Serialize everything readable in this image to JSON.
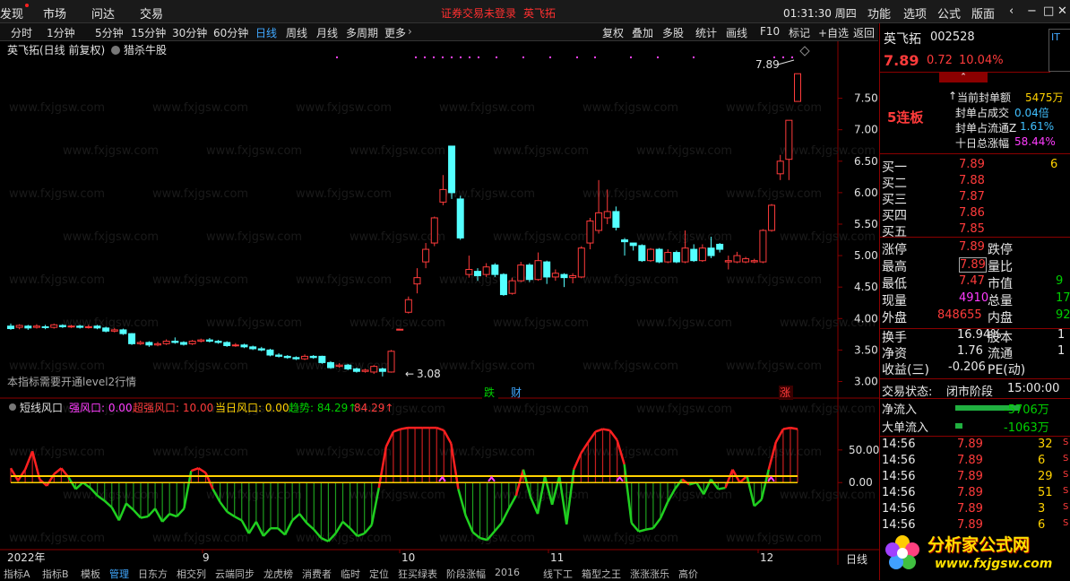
{
  "menubar": {
    "items": [
      "发现",
      "市场",
      "问达",
      "交易"
    ],
    "status_notice": "证券交易未登录",
    "stock_name_top": "英飞拓",
    "clock": "01:31:30 周四",
    "right_items": [
      "功能",
      "选项",
      "公式",
      "版面"
    ],
    "window_controls": [
      "‹",
      "−",
      "□",
      "✕"
    ]
  },
  "periodbar": {
    "periods": [
      "分时",
      "1分钟",
      "5分钟",
      "15分钟",
      "30分钟",
      "60分钟",
      "日线",
      "周线",
      "月线",
      "多周期",
      "更多"
    ],
    "active": "日线",
    "tools": [
      "复权",
      "叠加",
      "多股",
      "统计",
      "画线",
      "F10",
      "标记",
      "+自选",
      "返回"
    ]
  },
  "chart": {
    "title": "英飞拓(日线 前复权)",
    "indicator_name": "猎杀牛股",
    "high_label": "7.89",
    "low_label": "3.08",
    "level2_note": "本指标需要开通level2行情",
    "markers": {
      "die": "跌",
      "cai": "财",
      "zhang": "涨"
    },
    "y_labels": [
      "7.50",
      "7.00",
      "6.50",
      "6.00",
      "5.50",
      "5.00",
      "4.50",
      "4.00",
      "3.50",
      "3.00"
    ],
    "x_labels": [
      "2022年",
      "9",
      "10",
      "11",
      "12"
    ],
    "period_label": "日线",
    "sub_y_labels": [
      "50.00",
      "0.00"
    ],
    "sub_title": "短线风口",
    "sub_legend": [
      {
        "label": "强风口:",
        "value": "0.00",
        "color": "#ff3cff"
      },
      {
        "label": "超强风口:",
        "value": "10.00",
        "color": "#ff3b3b"
      },
      {
        "label": "当日风口:",
        "value": "0.00",
        "color": "#ffd200"
      },
      {
        "label": "趋势:",
        "value": "84.29↑",
        "color": "#00d000"
      },
      {
        "label": "",
        "value": "84.29↑",
        "color": "#ff3b3b"
      }
    ]
  },
  "chart_data": {
    "type": "candlestick",
    "y_range": [
      2.85,
      7.95
    ],
    "candles": [
      {
        "o": 3.88,
        "c": 3.84,
        "h": 3.92,
        "l": 3.82
      },
      {
        "o": 3.86,
        "c": 3.89,
        "h": 3.91,
        "l": 3.83
      },
      {
        "o": 3.88,
        "c": 3.85,
        "h": 3.9,
        "l": 3.82
      },
      {
        "o": 3.86,
        "c": 3.88,
        "h": 3.91,
        "l": 3.84
      },
      {
        "o": 3.87,
        "c": 3.86,
        "h": 3.9,
        "l": 3.83
      },
      {
        "o": 3.86,
        "c": 3.9,
        "h": 3.92,
        "l": 3.84
      },
      {
        "o": 3.89,
        "c": 3.87,
        "h": 3.91,
        "l": 3.85
      },
      {
        "o": 3.87,
        "c": 3.88,
        "h": 3.9,
        "l": 3.85
      },
      {
        "o": 3.88,
        "c": 3.86,
        "h": 3.9,
        "l": 3.84
      },
      {
        "o": 3.86,
        "c": 3.87,
        "h": 3.9,
        "l": 3.84
      },
      {
        "o": 3.88,
        "c": 3.85,
        "h": 3.9,
        "l": 3.83
      },
      {
        "o": 3.85,
        "c": 3.8,
        "h": 3.87,
        "l": 3.78
      },
      {
        "o": 3.8,
        "c": 3.82,
        "h": 3.85,
        "l": 3.78
      },
      {
        "o": 3.82,
        "c": 3.76,
        "h": 3.84,
        "l": 3.74
      },
      {
        "o": 3.76,
        "c": 3.6,
        "h": 3.77,
        "l": 3.58
      },
      {
        "o": 3.6,
        "c": 3.62,
        "h": 3.65,
        "l": 3.58
      },
      {
        "o": 3.62,
        "c": 3.58,
        "h": 3.64,
        "l": 3.55
      },
      {
        "o": 3.58,
        "c": 3.6,
        "h": 3.63,
        "l": 3.56
      },
      {
        "o": 3.6,
        "c": 3.64,
        "h": 3.67,
        "l": 3.58
      },
      {
        "o": 3.64,
        "c": 3.62,
        "h": 3.7,
        "l": 3.6
      },
      {
        "o": 3.62,
        "c": 3.59,
        "h": 3.64,
        "l": 3.57
      },
      {
        "o": 3.6,
        "c": 3.64,
        "h": 3.66,
        "l": 3.58
      },
      {
        "o": 3.64,
        "c": 3.66,
        "h": 3.68,
        "l": 3.62
      },
      {
        "o": 3.66,
        "c": 3.64,
        "h": 3.69,
        "l": 3.62
      },
      {
        "o": 3.64,
        "c": 3.62,
        "h": 3.66,
        "l": 3.6
      },
      {
        "o": 3.62,
        "c": 3.57,
        "h": 3.64,
        "l": 3.55
      },
      {
        "o": 3.57,
        "c": 3.58,
        "h": 3.61,
        "l": 3.55
      },
      {
        "o": 3.58,
        "c": 3.55,
        "h": 3.6,
        "l": 3.53
      },
      {
        "o": 3.55,
        "c": 3.52,
        "h": 3.57,
        "l": 3.5
      },
      {
        "o": 3.52,
        "c": 3.5,
        "h": 3.55,
        "l": 3.48
      },
      {
        "o": 3.5,
        "c": 3.42,
        "h": 3.52,
        "l": 3.4
      },
      {
        "o": 3.42,
        "c": 3.4,
        "h": 3.45,
        "l": 3.38
      },
      {
        "o": 3.4,
        "c": 3.38,
        "h": 3.42,
        "l": 3.36
      },
      {
        "o": 3.38,
        "c": 3.36,
        "h": 3.4,
        "l": 3.34
      },
      {
        "o": 3.36,
        "c": 3.4,
        "h": 3.43,
        "l": 3.34
      },
      {
        "o": 3.4,
        "c": 3.38,
        "h": 3.42,
        "l": 3.36
      },
      {
        "o": 3.4,
        "c": 3.3,
        "h": 3.41,
        "l": 3.28
      },
      {
        "o": 3.3,
        "c": 3.22,
        "h": 3.32,
        "l": 3.2
      },
      {
        "o": 3.24,
        "c": 3.26,
        "h": 3.29,
        "l": 3.22
      },
      {
        "o": 3.26,
        "c": 3.2,
        "h": 3.28,
        "l": 3.18
      },
      {
        "o": 3.2,
        "c": 3.16,
        "h": 3.22,
        "l": 3.14
      },
      {
        "o": 3.16,
        "c": 3.18,
        "h": 3.2,
        "l": 3.14
      },
      {
        "o": 3.15,
        "c": 3.24,
        "h": 3.26,
        "l": 3.12
      },
      {
        "o": 3.2,
        "c": 3.16,
        "h": 3.22,
        "l": 3.08
      },
      {
        "o": 3.15,
        "c": 3.48,
        "h": 3.5,
        "l": 3.14
      },
      {
        "o": 3.83,
        "c": 3.83,
        "h": 3.83,
        "l": 3.83
      },
      {
        "o": 4.1,
        "c": 4.3,
        "h": 4.35,
        "l": 4.08
      },
      {
        "o": 4.55,
        "c": 4.65,
        "h": 4.8,
        "l": 4.4
      },
      {
        "o": 4.9,
        "c": 5.1,
        "h": 5.2,
        "l": 4.8
      },
      {
        "o": 5.2,
        "c": 5.6,
        "h": 5.62,
        "l": 5.15
      },
      {
        "o": 5.85,
        "c": 6.05,
        "h": 6.28,
        "l": 5.8
      },
      {
        "o": 6.74,
        "c": 6.0,
        "h": 6.74,
        "l": 5.9
      },
      {
        "o": 5.9,
        "c": 5.28,
        "h": 5.95,
        "l": 5.25
      },
      {
        "o": 4.7,
        "c": 4.78,
        "h": 5.0,
        "l": 4.65
      },
      {
        "o": 4.75,
        "c": 4.68,
        "h": 4.8,
        "l": 4.6
      },
      {
        "o": 4.7,
        "c": 4.82,
        "h": 4.88,
        "l": 4.66
      },
      {
        "o": 4.85,
        "c": 4.7,
        "h": 4.88,
        "l": 4.66
      },
      {
        "o": 4.7,
        "c": 4.38,
        "h": 4.72,
        "l": 4.36
      },
      {
        "o": 4.4,
        "c": 4.6,
        "h": 4.65,
        "l": 4.38
      },
      {
        "o": 4.6,
        "c": 4.85,
        "h": 4.9,
        "l": 4.58
      },
      {
        "o": 4.85,
        "c": 4.62,
        "h": 4.88,
        "l": 4.58
      },
      {
        "o": 4.62,
        "c": 4.92,
        "h": 5.05,
        "l": 4.6
      },
      {
        "o": 4.9,
        "c": 4.66,
        "h": 4.92,
        "l": 4.55
      },
      {
        "o": 4.66,
        "c": 4.72,
        "h": 4.78,
        "l": 4.6
      },
      {
        "o": 4.7,
        "c": 4.65,
        "h": 4.72,
        "l": 4.5
      },
      {
        "o": 4.65,
        "c": 4.68,
        "h": 4.72,
        "l": 4.56
      },
      {
        "o": 4.66,
        "c": 5.12,
        "h": 5.15,
        "l": 4.64
      },
      {
        "o": 5.2,
        "c": 5.55,
        "h": 5.6,
        "l": 5.1
      },
      {
        "o": 5.4,
        "c": 5.68,
        "h": 6.2,
        "l": 5.35
      },
      {
        "o": 5.6,
        "c": 5.7,
        "h": 6.05,
        "l": 5.5
      },
      {
        "o": 5.7,
        "c": 5.45,
        "h": 5.78,
        "l": 5.4
      },
      {
        "o": 5.25,
        "c": 5.22,
        "h": 5.28,
        "l": 5.0
      },
      {
        "o": 5.2,
        "c": 5.16,
        "h": 5.2,
        "l": 5.08
      },
      {
        "o": 5.16,
        "c": 4.92,
        "h": 5.18,
        "l": 4.9
      },
      {
        "o": 4.92,
        "c": 5.1,
        "h": 5.12,
        "l": 4.9
      },
      {
        "o": 5.1,
        "c": 4.9,
        "h": 5.12,
        "l": 4.88
      },
      {
        "o": 4.9,
        "c": 5.05,
        "h": 5.1,
        "l": 4.88
      },
      {
        "o": 5.05,
        "c": 4.9,
        "h": 5.08,
        "l": 4.88
      },
      {
        "o": 4.9,
        "c": 5.12,
        "h": 5.4,
        "l": 4.88
      },
      {
        "o": 5.1,
        "c": 4.92,
        "h": 5.18,
        "l": 4.9
      },
      {
        "o": 4.92,
        "c": 5.12,
        "h": 5.18,
        "l": 4.9
      },
      {
        "o": 5.12,
        "c": 5.0,
        "h": 5.3,
        "l": 4.96
      },
      {
        "o": 5.18,
        "c": 5.1,
        "h": 5.2,
        "l": 5.05
      },
      {
        "o": 4.9,
        "c": 4.92,
        "h": 5.0,
        "l": 4.78
      },
      {
        "o": 4.9,
        "c": 5.0,
        "h": 5.06,
        "l": 4.88
      },
      {
        "o": 4.9,
        "c": 4.95,
        "h": 4.98,
        "l": 4.88
      },
      {
        "o": 4.9,
        "c": 4.92,
        "h": 4.95,
        "l": 4.88
      },
      {
        "o": 4.9,
        "c": 5.4,
        "h": 5.42,
        "l": 4.88
      },
      {
        "o": 5.4,
        "c": 5.8,
        "h": 5.82,
        "l": 5.38
      },
      {
        "o": 6.3,
        "c": 6.5,
        "h": 6.6,
        "l": 6.2
      },
      {
        "o": 6.53,
        "c": 7.15,
        "h": 7.15,
        "l": 6.2
      },
      {
        "o": 7.45,
        "c": 7.89,
        "h": 7.89,
        "l": 7.45
      }
    ],
    "sub_y_range": [
      -100,
      102
    ],
    "trend": [
      22,
      3,
      20,
      48,
      5,
      -5,
      13,
      22,
      8,
      -10,
      0,
      -8,
      -20,
      -28,
      -38,
      -58,
      -32,
      -42,
      -54,
      -52,
      -40,
      -60,
      -48,
      -52,
      -40,
      18,
      22,
      15,
      -10,
      -30,
      -45,
      -52,
      -58,
      -78,
      -60,
      -82,
      -70,
      -70,
      -80,
      -58,
      -48,
      -62,
      -72,
      -85,
      -90,
      -78,
      -60,
      -70,
      -82,
      -78,
      -65,
      -8,
      55,
      78,
      82,
      84,
      84,
      84,
      84,
      84,
      80,
      60,
      -10,
      -50,
      -76,
      -85,
      -88,
      -75,
      -62,
      -40,
      -20,
      20,
      -22,
      -48,
      10,
      -34,
      10,
      -64,
      20,
      45,
      62,
      78,
      82,
      80,
      65,
      28,
      -62,
      -75,
      -72,
      -70,
      -55,
      -30,
      -10,
      5,
      -3,
      0,
      -18,
      5,
      -10,
      -8,
      20,
      0,
      10,
      -36,
      -26,
      20,
      62,
      82,
      84,
      82
    ]
  },
  "quote": {
    "name": "英飞拓",
    "code": "002528",
    "price": "7.89",
    "change": "0.72",
    "pct": "10.04%",
    "badge": "5连板",
    "seal": [
      {
        "label": "当前封单额",
        "value": "5475万",
        "color": "#ffd200"
      },
      {
        "label": "封单占成交",
        "value": "0.04倍",
        "color": "#40c0ff"
      },
      {
        "label": "封单占流通Z",
        "value": "1.61%",
        "color": "#40c0ff"
      },
      {
        "label": "十日总涨幅",
        "value": "58.44%",
        "color": "#ff3cff"
      }
    ],
    "bids": [
      {
        "label": "买一",
        "price": "7.89",
        "vol": "6"
      },
      {
        "label": "买二",
        "price": "7.88",
        "vol": ""
      },
      {
        "label": "买三",
        "price": "7.87",
        "vol": ""
      },
      {
        "label": "买四",
        "price": "7.86",
        "vol": ""
      },
      {
        "label": "买五",
        "price": "7.85",
        "vol": ""
      }
    ],
    "stats_left": [
      {
        "label": "涨停",
        "value": "7.89",
        "color": "#ff3b3b"
      },
      {
        "label": "最高",
        "value": "7.89",
        "color": "#ff3b3b"
      },
      {
        "label": "最低",
        "value": "7.47",
        "color": "#ff3b3b"
      },
      {
        "label": "现量",
        "value": "4910",
        "color": "#ff3cff"
      },
      {
        "label": "外盘",
        "value": "848655",
        "color": "#ff3b3b"
      }
    ],
    "stats_right": [
      {
        "label": "跌停",
        "value": ""
      },
      {
        "label": "量比",
        "value": ""
      },
      {
        "label": "市值",
        "value": "9"
      },
      {
        "label": "总量",
        "value": "17"
      },
      {
        "label": "内盘",
        "value": "92"
      }
    ],
    "fund": [
      {
        "label": "换手",
        "value": "16.94%",
        "label2": "股本",
        "value2": "1"
      },
      {
        "label": "净资",
        "value": "1.76",
        "label2": "流通",
        "value2": "1"
      },
      {
        "label": "收益(三)",
        "value": "-0.206",
        "label2": "PE(动)",
        "value2": ""
      }
    ],
    "trade_status_label": "交易状态:",
    "trade_status": "闭市阶段",
    "trade_time": "15:00:00",
    "net_inflow_label": "净流入",
    "net_inflow": "-5706万",
    "big_inflow_label": "大单流入",
    "big_inflow": "-1063万",
    "ticks": [
      {
        "t": "14:56",
        "p": "7.89",
        "v": "32"
      },
      {
        "t": "14:56",
        "p": "7.89",
        "v": "6"
      },
      {
        "t": "14:56",
        "p": "7.89",
        "v": "29"
      },
      {
        "t": "14:56",
        "p": "7.89",
        "v": "51"
      },
      {
        "t": "14:56",
        "p": "7.89",
        "v": "3"
      },
      {
        "t": "14:56",
        "p": "7.89",
        "v": "6"
      }
    ]
  },
  "bottom_tabs": [
    "指标A",
    "指标B",
    "模板",
    "管理",
    "日东方",
    "相交列",
    "云端同步",
    "龙虎榜",
    "消费者",
    "临时",
    "定位",
    "狂买绿表",
    "阶段涨幅",
    "2016",
    "线下工",
    "箱型之王",
    "涨涨涨乐",
    "高价"
  ],
  "logo": {
    "text": "分析家公式网",
    "url": "www.fxjgsw.com"
  },
  "colors": {
    "up": "#ff3b3b",
    "down": "#54ffff",
    "border": "#8b0000",
    "accent_yellow": "#ffd200"
  }
}
